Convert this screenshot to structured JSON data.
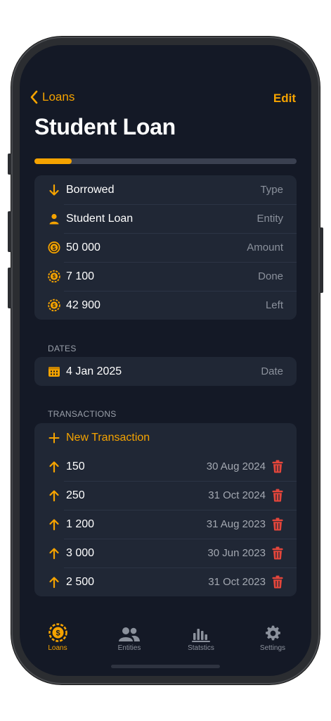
{
  "nav": {
    "back_label": "Loans",
    "edit_label": "Edit"
  },
  "page": {
    "title": "Student Loan"
  },
  "progress": {
    "fraction": 0.142,
    "fill_color": "#f5a300",
    "track_color": "#3a4050"
  },
  "details": [
    {
      "value": "Borrowed",
      "label": "Type",
      "icon": "arrow-down-icon"
    },
    {
      "value": "Student Loan",
      "label": "Entity",
      "icon": "person-icon"
    },
    {
      "value": "50 000",
      "label": "Amount",
      "icon": "dollar-coin-icon"
    },
    {
      "value": "7 100",
      "label": "Done",
      "icon": "coin-done-icon"
    },
    {
      "value": "42 900",
      "label": "Left",
      "icon": "coin-left-icon"
    }
  ],
  "dates": {
    "header": "DATES",
    "items": [
      {
        "value": "4 Jan 2025",
        "label": "Date",
        "icon": "calendar-icon"
      }
    ]
  },
  "transactions": {
    "header": "TRANSACTIONS",
    "new_label": "New Transaction",
    "items": [
      {
        "amount": "150",
        "date": "30 Aug 2024"
      },
      {
        "amount": "250",
        "date": "31 Oct 2024"
      },
      {
        "amount": "1 200",
        "date": "31 Aug 2023"
      },
      {
        "amount": "3 000",
        "date": "30 Jun 2023"
      },
      {
        "amount": "2 500",
        "date": "31 Oct 2023"
      }
    ]
  },
  "tabs": [
    {
      "label": "Loans",
      "icon": "coin-icon",
      "active": true
    },
    {
      "label": "Entities",
      "icon": "people-icon",
      "active": false
    },
    {
      "label": "Statstics",
      "icon": "bar-chart-icon",
      "active": false
    },
    {
      "label": "Settings",
      "icon": "gear-icon",
      "active": false
    }
  ],
  "colors": {
    "accent": "#f5a300",
    "danger": "#e5463b",
    "background": "#141926",
    "card": "#202735"
  }
}
